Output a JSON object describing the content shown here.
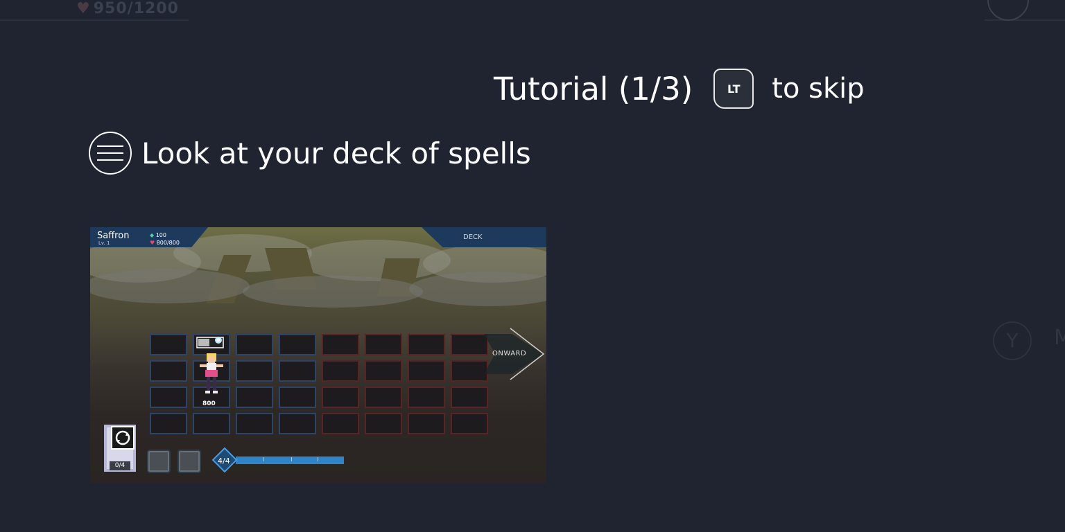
{
  "background_hud": {
    "hp_text": "950/1200",
    "side_button_letter": "Y",
    "side_letter": "M"
  },
  "tutorial": {
    "title": "Tutorial (1/3)",
    "button_label": "LT",
    "skip_text": "to skip"
  },
  "instruction": {
    "text": "Look at your deck of spells"
  },
  "preview": {
    "player_name": "Saffron",
    "player_level": "Lv. 1",
    "gem_value": "100",
    "hp_value": "800/800",
    "deck_label": "DECK",
    "onward_label": "ONWARD",
    "character_hp": "800",
    "deck_count": "0/4",
    "mana_label": "4/4",
    "mana_fraction": 1.0,
    "grid_rows": 4,
    "grid_cols": 8,
    "player_side_cols": 4
  },
  "colors": {
    "background": "#1f2430",
    "panel_blue": "#1d3a5c",
    "player_tile_border": "#2b4468",
    "enemy_tile_border": "#5a2424",
    "mana_bar": "#2e84c6",
    "gem": "#48d0b4",
    "heart": "#e24a6a"
  },
  "icons": {
    "menu": "hamburger-circle-icon",
    "trigger": "lt-trigger-icon",
    "heart": "heart-icon",
    "gem": "gem-icon",
    "refresh": "refresh-icon"
  }
}
